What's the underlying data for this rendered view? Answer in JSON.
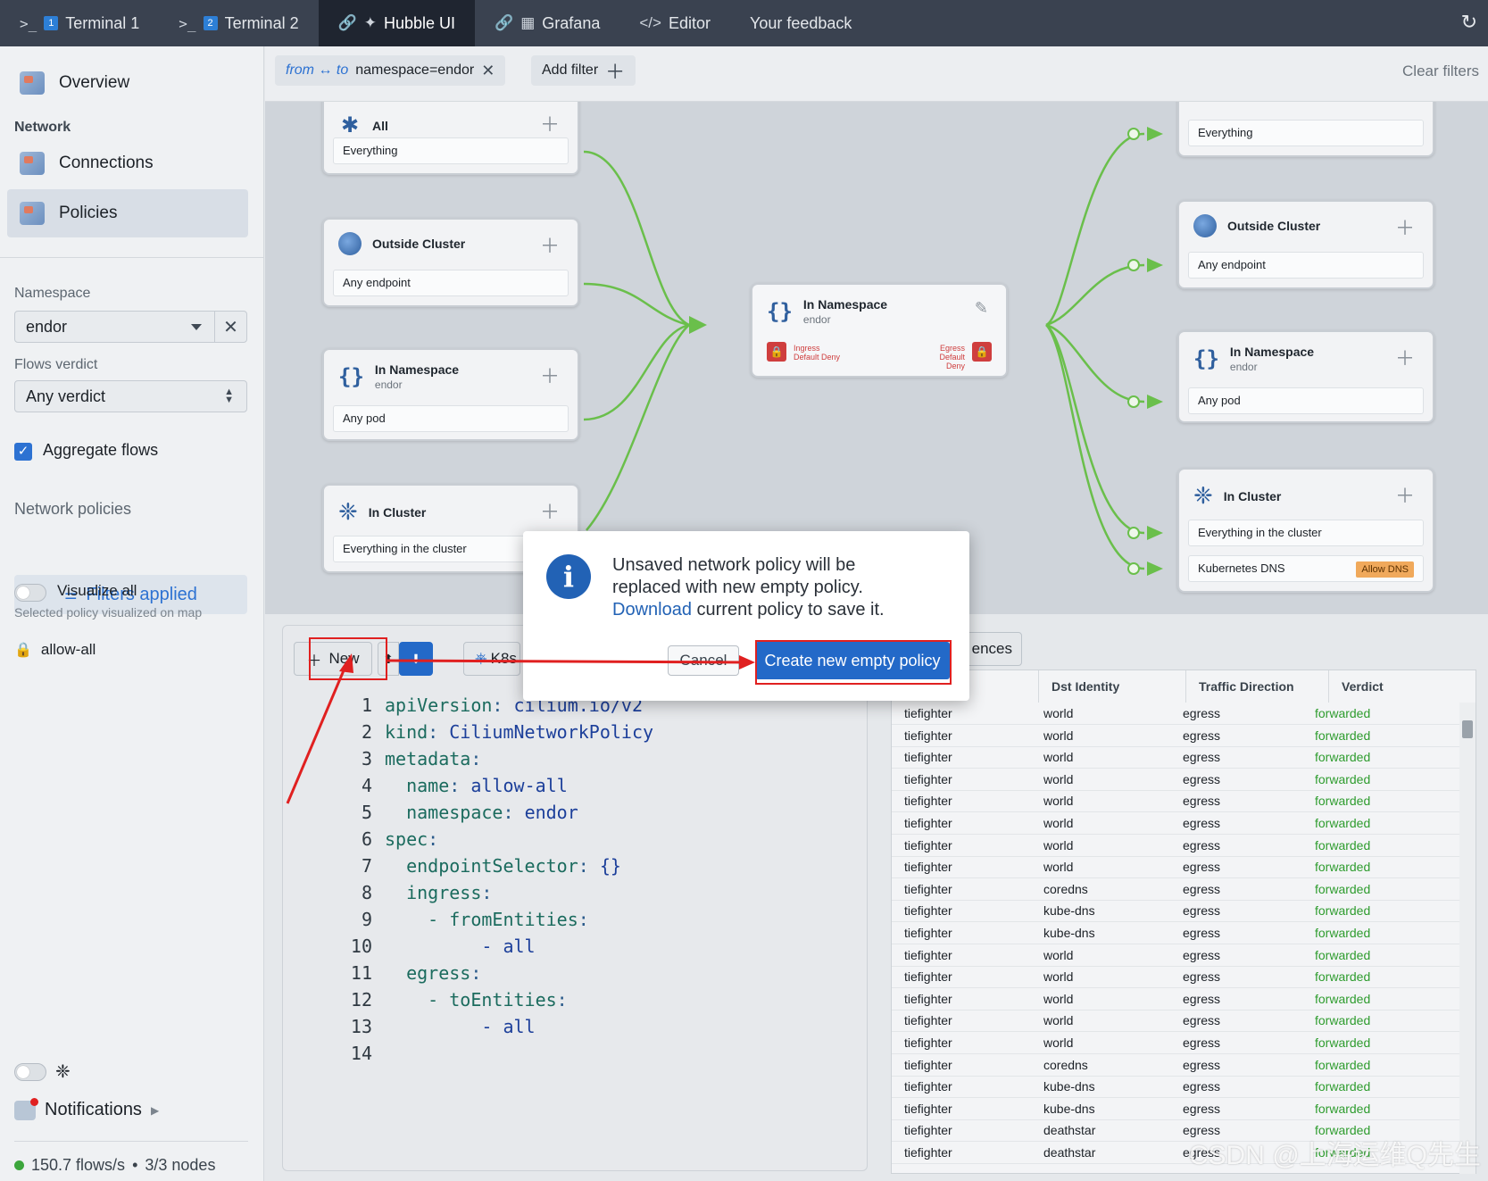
{
  "tabs": [
    {
      "prompt": ">_",
      "num": "1",
      "label": "Terminal 1"
    },
    {
      "prompt": ">_",
      "num": "2",
      "label": "Terminal 2"
    },
    {
      "label": "Hubble UI",
      "active": true
    },
    {
      "label": "Grafana"
    },
    {
      "label": "Editor"
    },
    {
      "label": "Your feedback"
    }
  ],
  "sidebar": {
    "overview": "Overview",
    "network_label": "Network",
    "connections": "Connections",
    "policies": "Policies",
    "namespace_label": "Namespace",
    "namespace_value": "endor",
    "flows_verdict_label": "Flows verdict",
    "flows_verdict_value": "Any verdict",
    "aggregate_flows": "Aggregate flows",
    "network_policies_label": "Network policies",
    "filters_applied": "Filters applied",
    "visualize_all": "Visualize all",
    "visualize_hint": "Selected policy visualized on map",
    "policy_item": "allow-all",
    "notifications": "Notifications",
    "flows_rate": "150.7 flows/s",
    "nodes": "3/3 nodes"
  },
  "filterbar": {
    "direction": "from ↔ to",
    "filter_value": "namespace=endor",
    "add_filter": "Add filter",
    "clear_filters": "Clear filters"
  },
  "map": {
    "left_cards": [
      {
        "title": "All",
        "sub": "",
        "row": "Everything"
      },
      {
        "title": "Outside Cluster",
        "sub": "",
        "row": "Any endpoint"
      },
      {
        "title": "In Namespace",
        "sub": "endor",
        "row": "Any pod"
      },
      {
        "title": "In Cluster",
        "sub": "",
        "row": "Everything in the cluster"
      }
    ],
    "center": {
      "title": "In Namespace",
      "sub": "endor",
      "ingress": "Ingress",
      "ingress2": "Default Deny",
      "egress": "Egress",
      "egress2": "Default Deny"
    },
    "right_cards": [
      {
        "title": "",
        "sub": "",
        "row": "Everything"
      },
      {
        "title": "Outside Cluster",
        "sub": "",
        "row": "Any endpoint"
      },
      {
        "title": "In Namespace",
        "sub": "endor",
        "row": "Any pod"
      },
      {
        "title": "In Cluster",
        "sub": "",
        "row": "Everything in the cluster",
        "row2": "Kubernetes DNS",
        "badge": "Allow DNS"
      }
    ],
    "edge_color": "#6abf4b"
  },
  "editor": {
    "new_label": "New",
    "k8s_label": "K8s",
    "refs_label": "ences",
    "lines": [
      {
        "n": "1",
        "k": "apiVersion",
        "v": "cilium.io/v2",
        "indent": 0
      },
      {
        "n": "2",
        "k": "kind",
        "v": "CiliumNetworkPolicy",
        "indent": 0
      },
      {
        "n": "3",
        "k": "metadata",
        "v": "",
        "indent": 0
      },
      {
        "n": "4",
        "k": "name",
        "v": "allow-all",
        "indent": 1
      },
      {
        "n": "5",
        "k": "namespace",
        "v": "endor",
        "indent": 1
      },
      {
        "n": "6",
        "k": "spec",
        "v": "",
        "indent": 0
      },
      {
        "n": "7",
        "k": "endpointSelector",
        "v": "{}",
        "indent": 1
      },
      {
        "n": "8",
        "k": "ingress",
        "v": "",
        "indent": 1
      },
      {
        "n": "9",
        "k": "- fromEntities",
        "v": "",
        "indent": 2
      },
      {
        "n": "10",
        "k": "",
        "v": "- all",
        "indent": 4
      },
      {
        "n": "11",
        "k": "egress",
        "v": "",
        "indent": 1
      },
      {
        "n": "12",
        "k": "- toEntities",
        "v": "",
        "indent": 2
      },
      {
        "n": "13",
        "k": "",
        "v": "- all",
        "indent": 4
      },
      {
        "n": "14",
        "k": "",
        "v": "",
        "indent": 0
      }
    ]
  },
  "table": {
    "headers": [
      "Dst Identity",
      "Traffic Direction",
      "Verdict"
    ],
    "rows": [
      [
        "tiefighter",
        "world",
        "egress",
        "forwarded"
      ],
      [
        "tiefighter",
        "world",
        "egress",
        "forwarded"
      ],
      [
        "tiefighter",
        "world",
        "egress",
        "forwarded"
      ],
      [
        "tiefighter",
        "world",
        "egress",
        "forwarded"
      ],
      [
        "tiefighter",
        "world",
        "egress",
        "forwarded"
      ],
      [
        "tiefighter",
        "world",
        "egress",
        "forwarded"
      ],
      [
        "tiefighter",
        "world",
        "egress",
        "forwarded"
      ],
      [
        "tiefighter",
        "world",
        "egress",
        "forwarded"
      ],
      [
        "tiefighter",
        "coredns",
        "egress",
        "forwarded"
      ],
      [
        "tiefighter",
        "kube-dns",
        "egress",
        "forwarded"
      ],
      [
        "tiefighter",
        "kube-dns",
        "egress",
        "forwarded"
      ],
      [
        "tiefighter",
        "world",
        "egress",
        "forwarded"
      ],
      [
        "tiefighter",
        "world",
        "egress",
        "forwarded"
      ],
      [
        "tiefighter",
        "world",
        "egress",
        "forwarded"
      ],
      [
        "tiefighter",
        "world",
        "egress",
        "forwarded"
      ],
      [
        "tiefighter",
        "world",
        "egress",
        "forwarded"
      ],
      [
        "tiefighter",
        "coredns",
        "egress",
        "forwarded"
      ],
      [
        "tiefighter",
        "kube-dns",
        "egress",
        "forwarded"
      ],
      [
        "tiefighter",
        "kube-dns",
        "egress",
        "forwarded"
      ],
      [
        "tiefighter",
        "deathstar",
        "egress",
        "forwarded"
      ],
      [
        "tiefighter",
        "deathstar",
        "egress",
        "forwarded"
      ]
    ]
  },
  "modal": {
    "line1": "Unsaved network policy will be",
    "line2": "replaced with new empty policy.",
    "download": "Download",
    "line3_rest": " current policy to save it.",
    "cancel": "Cancel",
    "create": "Create new empty policy"
  },
  "watermark": "CSDN @上海运维Q先生",
  "colors": {
    "accent": "#2369c8",
    "annotation": "#e02020",
    "forwarded": "#2e9c2e"
  }
}
